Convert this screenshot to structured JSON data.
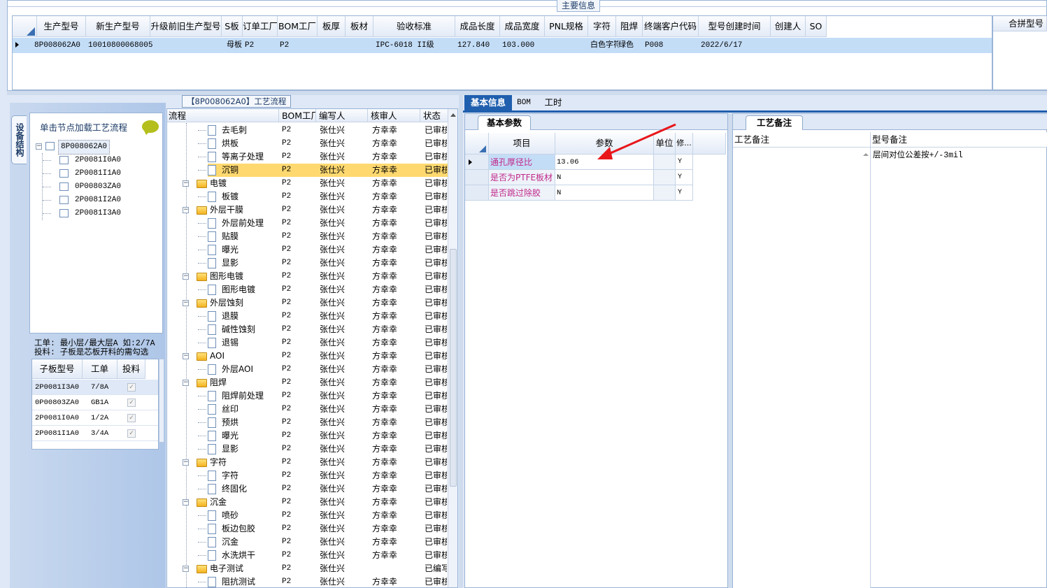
{
  "main_info": {
    "title": "主要信息",
    "columns": [
      "生产型号",
      "新生产型号",
      "升级前旧生产型号",
      "S板",
      "订单工厂",
      "BOM工厂",
      "板厚",
      "板材",
      "验收标准",
      "成品长度",
      "成品宽度",
      "PNL规格",
      "字符",
      "阻焊",
      "终端客户代码",
      "型号创建时间",
      "创建人",
      "SO"
    ],
    "row": [
      "8P008062A0",
      "10010800068005",
      "",
      "母板",
      "P2",
      "P2",
      "",
      "",
      "IPC-6018 II级",
      "127.840",
      "103.000",
      "",
      "白色字符",
      "绿色",
      "P008",
      "2022/6/17",
      "",
      ""
    ],
    "right_header": "合拼型号"
  },
  "left_panel": {
    "vtab_label": "设备结构",
    "hint": "单击节点加载工艺流程",
    "root": "8P008062A0",
    "children": [
      "2P0081I0A0",
      "2P0081I1A0",
      "0P00803ZA0",
      "2P0081I2A0",
      "2P0081I3A0"
    ],
    "note_line1": "工单: 最小层/最大层A 如:2/7A",
    "note_line2": "投料: 子板是芯板开料的需勾选",
    "sub_table_headers": [
      "子板型号",
      "工单",
      "投料"
    ],
    "sub_table_rows": [
      [
        "2P0081I3A0",
        "7/8A"
      ],
      [
        "0P00803ZA0",
        "GB1A"
      ],
      [
        "2P0081I0A0",
        "1/2A"
      ],
      [
        "2P0081I1A0",
        "3/4A"
      ]
    ]
  },
  "process_flow": {
    "title": "【8P008062A0】工艺流程",
    "headers": [
      "流程",
      "BOM工厂",
      "编写人",
      "核审人",
      "状态"
    ],
    "rows": [
      {
        "name": "去毛刺",
        "level": 2,
        "bom": "P2",
        "writer": "张仕兴",
        "reviewer": "方幸幸",
        "status": "已审核"
      },
      {
        "name": "烘板",
        "level": 2,
        "bom": "P2",
        "writer": "张仕兴",
        "reviewer": "方幸幸",
        "status": "已审核"
      },
      {
        "name": "等离子处理",
        "level": 2,
        "bom": "P2",
        "writer": "张仕兴",
        "reviewer": "方幸幸",
        "status": "已审核"
      },
      {
        "name": "沉铜",
        "level": 2,
        "bom": "P2",
        "writer": "张仕兴",
        "reviewer": "方幸幸",
        "status": "已审核",
        "selected": true
      },
      {
        "name": "电镀",
        "level": 1,
        "bom": "P2",
        "writer": "张仕兴",
        "reviewer": "方幸幸",
        "status": "已审核"
      },
      {
        "name": "板镀",
        "level": 2,
        "bom": "P2",
        "writer": "张仕兴",
        "reviewer": "方幸幸",
        "status": "已审核"
      },
      {
        "name": "外层干膜",
        "level": 1,
        "bom": "P2",
        "writer": "张仕兴",
        "reviewer": "方幸幸",
        "status": "已审核"
      },
      {
        "name": "外层前处理",
        "level": 2,
        "bom": "P2",
        "writer": "张仕兴",
        "reviewer": "方幸幸",
        "status": "已审核"
      },
      {
        "name": "贴膜",
        "level": 2,
        "bom": "P2",
        "writer": "张仕兴",
        "reviewer": "方幸幸",
        "status": "已审核"
      },
      {
        "name": "曝光",
        "level": 2,
        "bom": "P2",
        "writer": "张仕兴",
        "reviewer": "方幸幸",
        "status": "已审核"
      },
      {
        "name": "显影",
        "level": 2,
        "bom": "P2",
        "writer": "张仕兴",
        "reviewer": "方幸幸",
        "status": "已审核"
      },
      {
        "name": "图形电镀",
        "level": 1,
        "bom": "P2",
        "writer": "张仕兴",
        "reviewer": "方幸幸",
        "status": "已审核"
      },
      {
        "name": "图形电镀",
        "level": 2,
        "bom": "P2",
        "writer": "张仕兴",
        "reviewer": "方幸幸",
        "status": "已审核"
      },
      {
        "name": "外层蚀刻",
        "level": 1,
        "bom": "P2",
        "writer": "张仕兴",
        "reviewer": "方幸幸",
        "status": "已审核"
      },
      {
        "name": "退膜",
        "level": 2,
        "bom": "P2",
        "writer": "张仕兴",
        "reviewer": "方幸幸",
        "status": "已审核"
      },
      {
        "name": "碱性蚀刻",
        "level": 2,
        "bom": "P2",
        "writer": "张仕兴",
        "reviewer": "方幸幸",
        "status": "已审核"
      },
      {
        "name": "退锡",
        "level": 2,
        "bom": "P2",
        "writer": "张仕兴",
        "reviewer": "方幸幸",
        "status": "已审核"
      },
      {
        "name": "AOI",
        "level": 1,
        "bom": "P2",
        "writer": "张仕兴",
        "reviewer": "方幸幸",
        "status": "已审核"
      },
      {
        "name": "外层AOI",
        "level": 2,
        "bom": "P2",
        "writer": "张仕兴",
        "reviewer": "方幸幸",
        "status": "已审核"
      },
      {
        "name": "阻焊",
        "level": 1,
        "bom": "P2",
        "writer": "张仕兴",
        "reviewer": "方幸幸",
        "status": "已审核"
      },
      {
        "name": "阻焊前处理",
        "level": 2,
        "bom": "P2",
        "writer": "张仕兴",
        "reviewer": "方幸幸",
        "status": "已审核"
      },
      {
        "name": "丝印",
        "level": 2,
        "bom": "P2",
        "writer": "张仕兴",
        "reviewer": "方幸幸",
        "status": "已审核"
      },
      {
        "name": "预烘",
        "level": 2,
        "bom": "P2",
        "writer": "张仕兴",
        "reviewer": "方幸幸",
        "status": "已审核"
      },
      {
        "name": "曝光",
        "level": 2,
        "bom": "P2",
        "writer": "张仕兴",
        "reviewer": "方幸幸",
        "status": "已审核"
      },
      {
        "name": "显影",
        "level": 2,
        "bom": "P2",
        "writer": "张仕兴",
        "reviewer": "方幸幸",
        "status": "已审核"
      },
      {
        "name": "字符",
        "level": 1,
        "bom": "P2",
        "writer": "张仕兴",
        "reviewer": "方幸幸",
        "status": "已审核"
      },
      {
        "name": "字符",
        "level": 2,
        "bom": "P2",
        "writer": "张仕兴",
        "reviewer": "方幸幸",
        "status": "已审核"
      },
      {
        "name": "终固化",
        "level": 2,
        "bom": "P2",
        "writer": "张仕兴",
        "reviewer": "方幸幸",
        "status": "已审核"
      },
      {
        "name": "沉金",
        "level": 1,
        "bom": "P2",
        "writer": "张仕兴",
        "reviewer": "方幸幸",
        "status": "已审核"
      },
      {
        "name": "喷砂",
        "level": 2,
        "bom": "P2",
        "writer": "张仕兴",
        "reviewer": "方幸幸",
        "status": "已审核"
      },
      {
        "name": "板边包胶",
        "level": 2,
        "bom": "P2",
        "writer": "张仕兴",
        "reviewer": "方幸幸",
        "status": "已审核"
      },
      {
        "name": "沉金",
        "level": 2,
        "bom": "P2",
        "writer": "张仕兴",
        "reviewer": "方幸幸",
        "status": "已审核"
      },
      {
        "name": "水洗烘干",
        "level": 2,
        "bom": "P2",
        "writer": "张仕兴",
        "reviewer": "方幸幸",
        "status": "已审核"
      },
      {
        "name": "电子测试",
        "level": 1,
        "bom": "P2",
        "writer": "张仕兴",
        "reviewer": "",
        "status": "已编写"
      },
      {
        "name": "阻抗测试",
        "level": 2,
        "bom": "P2",
        "writer": "张仕兴",
        "reviewer": "方幸幸",
        "status": "已审核"
      }
    ]
  },
  "right_tabs": [
    "基本信息",
    "BOM",
    "工时"
  ],
  "params": {
    "tab": "基本参数",
    "headers": [
      "项目",
      "参数",
      "单位",
      "修..."
    ],
    "rows": [
      {
        "item": "通孔厚径比",
        "value": "13.06",
        "unit": "",
        "mod": "Y"
      },
      {
        "item": "是否为PTFE板材",
        "value": "N",
        "unit": "",
        "mod": "Y"
      },
      {
        "item": "是否跳过除胶",
        "value": "N",
        "unit": "",
        "mod": "Y"
      }
    ]
  },
  "remarks": {
    "tab": "工艺备注",
    "col1": "工艺备注",
    "col2": "型号备注",
    "model_remark": "层间对位公差按+/-3mil"
  },
  "colors": {
    "accent": "#1f5fae",
    "selected_row": "#c4ddf7",
    "highlight": "#ffd970",
    "pink_text": "#c0288a",
    "arrow": "#e8161b"
  }
}
